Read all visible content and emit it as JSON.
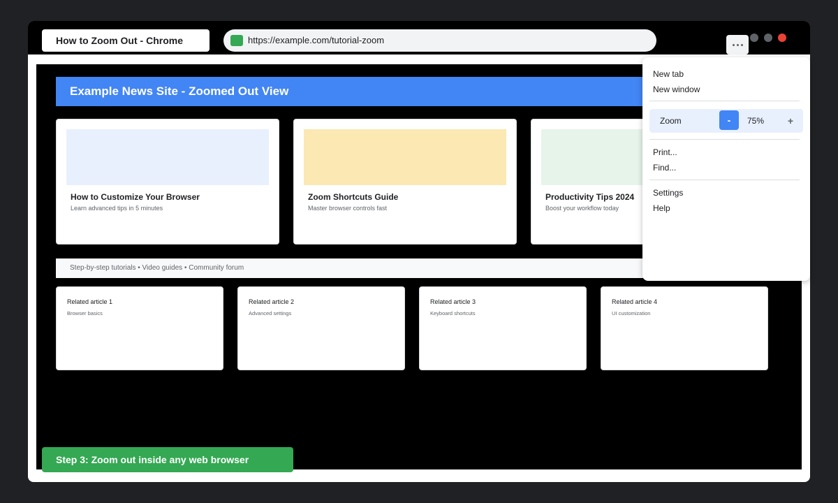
{
  "tab": {
    "title": "How to Zoom Out - Chrome"
  },
  "address_bar": {
    "url": "https://example.com/tutorial-zoom"
  },
  "colors": {
    "window_close": "#ea4335",
    "window_min": "#5f6368",
    "site_header": "#4285f4",
    "callout": "#34a853",
    "zoom_row_highlight": "#e8f0fe"
  },
  "page": {
    "header": "Example News Site - Zoomed Out View",
    "featured": [
      {
        "title": "How to Customize Your Browser",
        "subtitle": "Learn advanced tips in 5 minutes",
        "thumb_color": "#e8f0fe"
      },
      {
        "title": "Zoom Shortcuts Guide",
        "subtitle": "Master browser controls fast",
        "thumb_color": "#fce8b2"
      },
      {
        "title": "Productivity Tips 2024",
        "subtitle": "Boost your workflow today",
        "thumb_color": "#e6f4ea"
      }
    ],
    "strip": "Step-by-step tutorials • Video guides • Community forum",
    "related": [
      {
        "title": "Related article 1",
        "subtitle": "Browser basics"
      },
      {
        "title": "Related article 2",
        "subtitle": "Advanced settings"
      },
      {
        "title": "Related article 3",
        "subtitle": "Keyboard shortcuts"
      },
      {
        "title": "Related article 4",
        "subtitle": "UI customization"
      }
    ]
  },
  "menu": {
    "button_icon": "more-horizontal-icon",
    "new_tab": "New tab",
    "new_window": "New window",
    "zoom": {
      "label": "Zoom",
      "minus": "-",
      "value": "75%",
      "plus": "+"
    },
    "print": "Print...",
    "find": "Find...",
    "settings": "Settings",
    "help": "Help"
  },
  "callout": {
    "text": "Step 3: Zoom out inside any web browser"
  }
}
